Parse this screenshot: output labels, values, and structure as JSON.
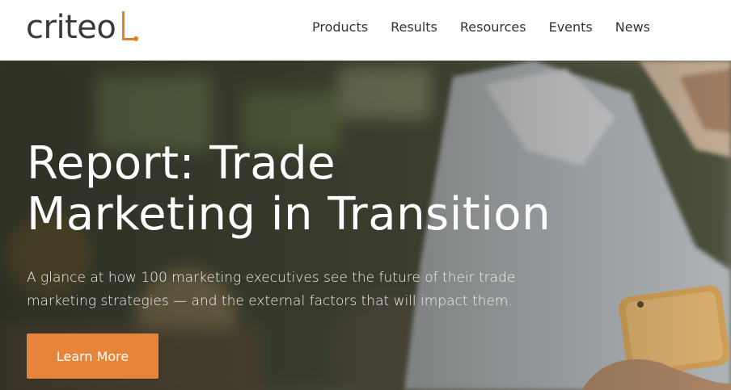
{
  "header": {
    "logo_text": "criteo",
    "nav": [
      {
        "label": "Products"
      },
      {
        "label": "Results"
      },
      {
        "label": "Resources"
      },
      {
        "label": "Events"
      },
      {
        "label": "News"
      }
    ]
  },
  "hero": {
    "title_line1": "Report: Trade",
    "title_line2": "Marketing in Transition",
    "description": "A glance at how 100 marketing executives see the future of their trade marketing strategies — and the external factors that will impact them.",
    "cta_label": "Learn More"
  },
  "colors": {
    "brand_orange": "#e8843a",
    "logo_text": "#3a3a3a",
    "nav_text": "#333333"
  }
}
